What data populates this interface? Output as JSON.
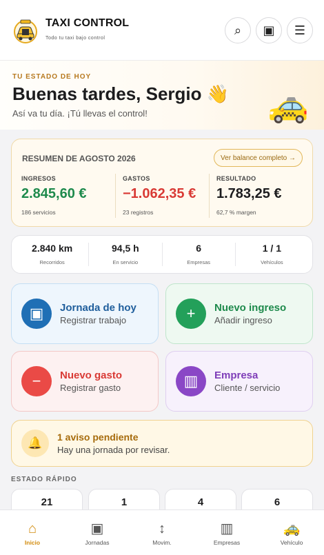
{
  "header": {
    "app_title": "TAXI CONTROL",
    "app_tagline": "Todo tu taxi bajo control",
    "logo_icon": "taxi-sign-logo-icon",
    "buttons": [
      {
        "icon": "search-icon",
        "glyph": "⌕"
      },
      {
        "icon": "wallet-icon",
        "glyph": "▣"
      },
      {
        "icon": "menu-icon",
        "glyph": "☰"
      }
    ]
  },
  "hero": {
    "kicker": "TU ESTADO DE HOY",
    "greeting": "Buenas tardes, Sergio 👋",
    "subtitle": "Así va tu día. ¡Tú llevas el control!",
    "car_glyph": "🚕"
  },
  "summary": {
    "title": "RESUMEN DE AGOSTO 2026",
    "balance_button": "Ver balance completo →",
    "columns": [
      {
        "label": "INGRESOS",
        "value": "2.845,60 €",
        "note": "186 servicios",
        "color": "#1e8a4c"
      },
      {
        "label": "GASTOS",
        "value": "−1.062,35 €",
        "note": "23 registros",
        "color": "#d93a35"
      },
      {
        "label": "RESULTADO",
        "value": "1.783,25 €",
        "note": "62,7 % margen",
        "color": "#1c1c1e"
      }
    ]
  },
  "stats": [
    {
      "value": "2.840 km",
      "label": "Recorridos"
    },
    {
      "value": "94,5 h",
      "label": "En servicio"
    },
    {
      "value": "6",
      "label": "Empresas"
    },
    {
      "value": "1 / 1",
      "label": "Vehículos"
    }
  ],
  "actions": [
    {
      "title": "Jornada de hoy",
      "subtitle": "Registrar trabajo",
      "glyph": "▣",
      "icon_color": "#1f6fb5",
      "title_color": "#1f5e9c"
    },
    {
      "title": "Nuevo ingreso",
      "subtitle": "Añadir ingreso",
      "glyph": "+",
      "icon_color": "#23a05a",
      "title_color": "#1e8a4c"
    },
    {
      "title": "Nuevo gasto",
      "subtitle": "Registrar gasto",
      "glyph": "−",
      "icon_color": "#ea4a46",
      "title_color": "#d93a35"
    },
    {
      "title": "Empresa",
      "subtitle": "Cliente / servicio",
      "glyph": "▥",
      "icon_color": "#8a47c6",
      "title_color": "#7e3db8"
    }
  ],
  "notice": {
    "icon": "bell-icon",
    "glyph": "🔔",
    "title": "1 aviso pendiente",
    "subtitle": "Hay una jornada por revisar."
  },
  "quick_status": {
    "label": "ESTADO RÁPIDO",
    "values": [
      "21",
      "1",
      "4",
      "6"
    ]
  },
  "bottom_nav": [
    {
      "label": "Inicio",
      "glyph": "⌂",
      "icon": "home-icon",
      "active": true
    },
    {
      "label": "Jornadas",
      "glyph": "▣",
      "icon": "calendar-icon",
      "active": false
    },
    {
      "label": "Movim.",
      "glyph": "↕",
      "icon": "transfer-icon",
      "active": false
    },
    {
      "label": "Empresas",
      "glyph": "▥",
      "icon": "building-icon",
      "active": false
    },
    {
      "label": "Vehículo",
      "glyph": "🚕",
      "icon": "taxi-icon",
      "active": false
    }
  ],
  "colors": {
    "accent": "#d28b0c",
    "hero_kicker": "#b7791f"
  }
}
